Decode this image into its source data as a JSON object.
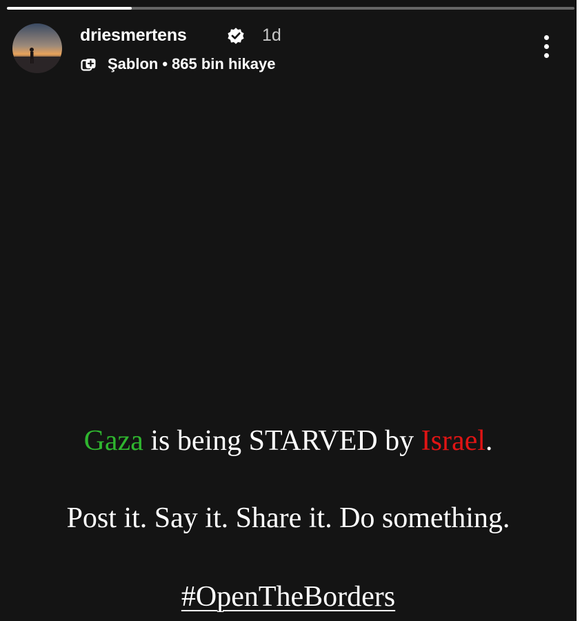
{
  "story": {
    "progress": 0.22,
    "username": "driesmertens",
    "verified": true,
    "time_ago": "1d",
    "template_label": "Şablon",
    "separator": "•",
    "stories_count": "865 bin hikaye",
    "icons": {
      "verified": "verified-badge-icon",
      "template": "template-copy-icon",
      "menu": "more-vertical-icon"
    }
  },
  "message": {
    "line1": {
      "word_gaza": "Gaza",
      "middle": " is being STARVED by ",
      "word_israel": "Israel",
      "end": "."
    },
    "line2": "Post it. Say it. Share it. Do something.",
    "hashtag": "#OpenTheBorders"
  },
  "colors": {
    "background": "#141414",
    "gaza": "#2fb52f",
    "israel": "#e01414",
    "text": "#ffffff"
  }
}
